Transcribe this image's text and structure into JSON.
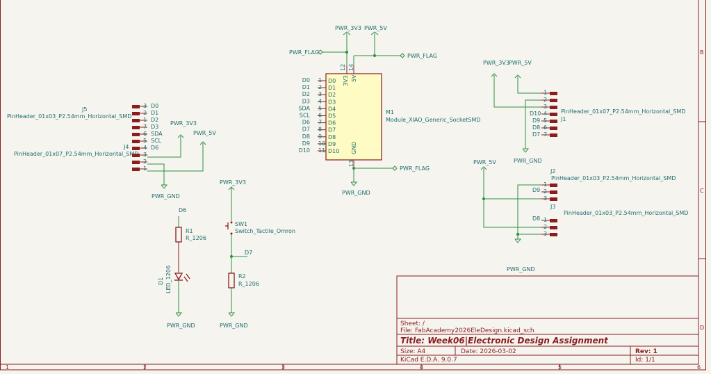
{
  "rulers": {
    "bottom": [
      "1",
      "2",
      "3",
      "4",
      "5",
      "6"
    ],
    "right": [
      "B",
      "C",
      "D"
    ]
  },
  "title_block": {
    "sheet": "Sheet: /",
    "file": "File: FabAcademy2026EleDesign.kicad_sch",
    "title": "Title: Week06|Electronic Design Assignment",
    "size": "Size: A4",
    "date": "Date: 2026-03-02",
    "rev": "Rev: 1",
    "tool": "KiCad E.D.A. 9.0.7",
    "id": "Id: 1/1"
  },
  "power": {
    "p3v3": "PWR_3V3",
    "p5v": "PWR_5V",
    "gnd": "PWR_GND",
    "flag": "PWR_FLAG"
  },
  "m1": {
    "ref": "M1",
    "value": "Module_XIAO_Generic_SocketSMD",
    "pin_3v3": "3V3",
    "pin_5v": "5V",
    "pin_gnd": "GND",
    "pin_num_12": "12",
    "pin_num_14": "14",
    "pin_num_13": "13",
    "left_nets": [
      "D0",
      "D1",
      "D2",
      "D3",
      "SDA",
      "SCL",
      "D6",
      "D7",
      "D8",
      "D9",
      "D10"
    ],
    "left_nums": [
      "1",
      "2",
      "3",
      "4",
      "5",
      "6",
      "7",
      "8",
      "9",
      "10",
      "11"
    ],
    "left_pins": [
      "D0",
      "D1",
      "D2",
      "D3",
      "D4",
      "D5",
      "D6",
      "D7",
      "D8",
      "D9",
      "D10"
    ]
  },
  "j5": {
    "ref": "J5",
    "value": "PinHeader_01x03_P2.54mm_Horizontal_SMD",
    "nets": [
      "D0",
      "D1",
      "D2"
    ],
    "nums": [
      "3",
      "2",
      "1"
    ]
  },
  "j4": {
    "ref": "J4",
    "value": "PinHeader_01x07_P2.54mm_Horizontal_SMD",
    "nets": [
      "D3",
      "SDA",
      "SCL",
      "D6"
    ],
    "nums": [
      "7",
      "6",
      "5",
      "4",
      "3",
      "2",
      "1"
    ]
  },
  "j1": {
    "ref": "J1",
    "value": "PinHeader_01x07_P2.54mm_Horizontal_SMD",
    "nets": [
      "D10",
      "D9",
      "D8",
      "D7"
    ],
    "nums": [
      "1",
      "2",
      "3",
      "4",
      "5",
      "6",
      "7"
    ]
  },
  "j2": {
    "ref": "J2",
    "value": "PinHeader_01x03_P2.54mm_Horizontal_SMD",
    "net": "D9",
    "nums": [
      "1",
      "2",
      "3"
    ]
  },
  "j3": {
    "ref": "J3",
    "value": "PinHeader_01x03_P2.54mm_Horizontal_SMD",
    "net": "D8",
    "nums": [
      "1",
      "2",
      "3"
    ]
  },
  "r1": {
    "ref": "R1",
    "value": "R_1206",
    "net": "D6"
  },
  "d1": {
    "ref": "D1",
    "value": "LED_1206"
  },
  "sw1": {
    "ref": "SW1",
    "value": "Switch_Tactile_Omron"
  },
  "r2": {
    "ref": "R2",
    "value": "R_1206",
    "net": "D7"
  }
}
